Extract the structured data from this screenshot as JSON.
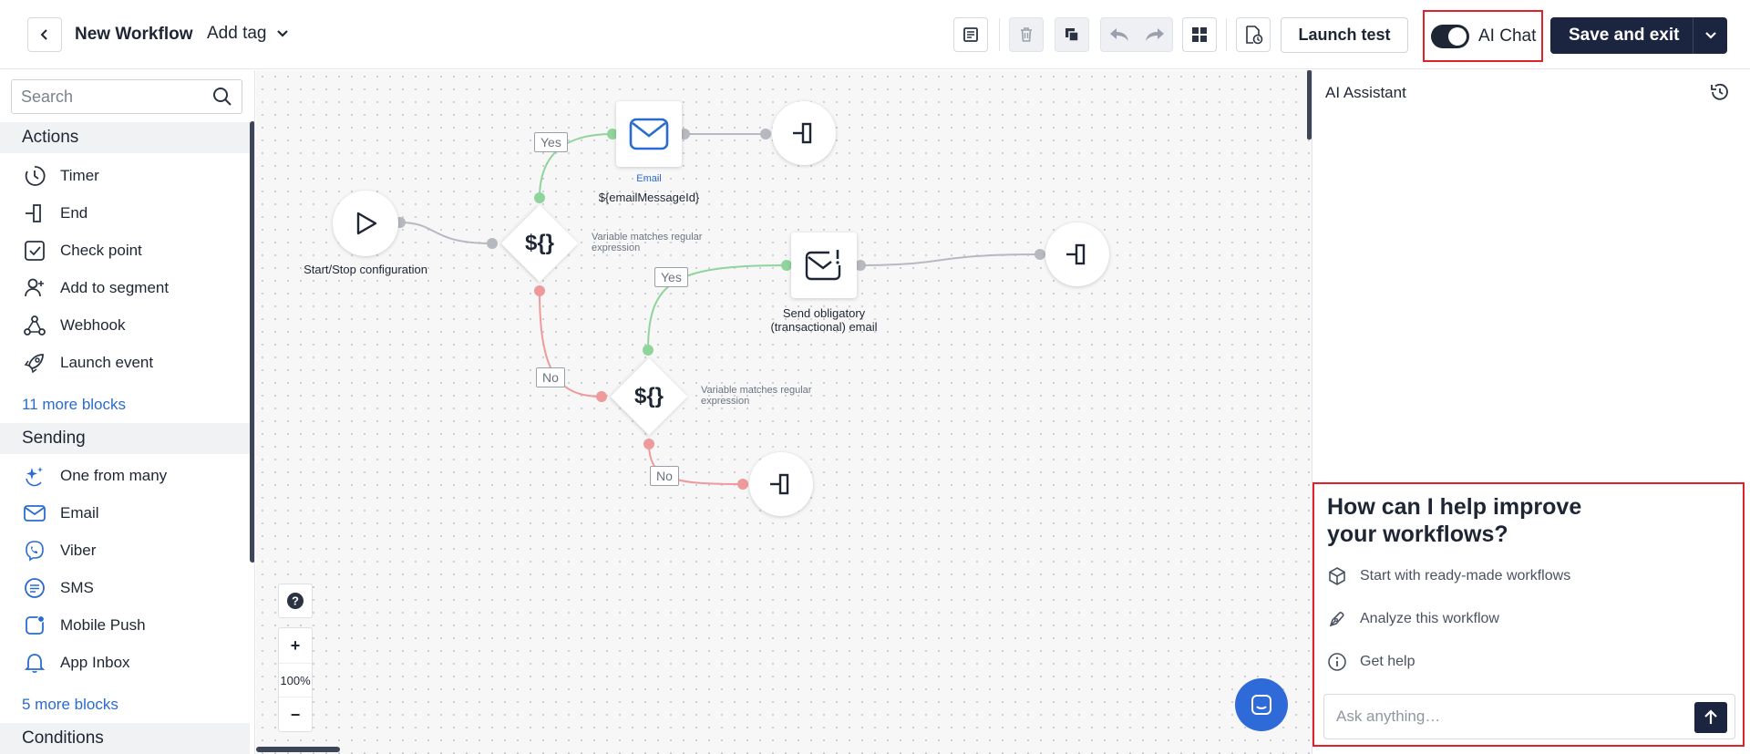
{
  "header": {
    "title": "New Workflow",
    "add_tag": "Add tag",
    "launch_test": "Launch test",
    "ai_chat": "AI Chat",
    "save_and_exit": "Save and exit"
  },
  "sidebar": {
    "search_placeholder": "Search",
    "sections": {
      "actions": "Actions",
      "sending": "Sending",
      "conditions": "Conditions"
    },
    "actions": [
      "Timer",
      "End",
      "Check point",
      "Add to segment",
      "Webhook",
      "Launch event"
    ],
    "actions_more": "11 more blocks",
    "sending": [
      "One from many",
      "Email",
      "Viber",
      "SMS",
      "Mobile Push",
      "App Inbox"
    ],
    "sending_more": "5 more blocks"
  },
  "canvas": {
    "start_label": "Start/Stop configuration",
    "email_type": "Email",
    "email_label": "${emailMessageId}",
    "condition_symbol": "${}",
    "condition1_label": "Variable matches regular expression",
    "condition2_label": "Variable matches regular expression",
    "send_obligatory_label": "Send obligatory (transactional) email",
    "yes": "Yes",
    "no": "No",
    "zoom": "100%",
    "zoom_in": "+",
    "zoom_out": "−",
    "help": "?"
  },
  "assistant": {
    "title": "AI Assistant",
    "headline": "How can I help improve your workflows?",
    "options": [
      "Start with ready-made workflows",
      "Analyze this workflow",
      "Get help"
    ],
    "input_placeholder": "Ask anything…"
  },
  "colors": {
    "accent_dark": "#1c2540",
    "yes_line": "#8fd49a",
    "no_line": "#ef9a9a",
    "link": "#2a6bd0",
    "highlight": "#e0202a"
  }
}
